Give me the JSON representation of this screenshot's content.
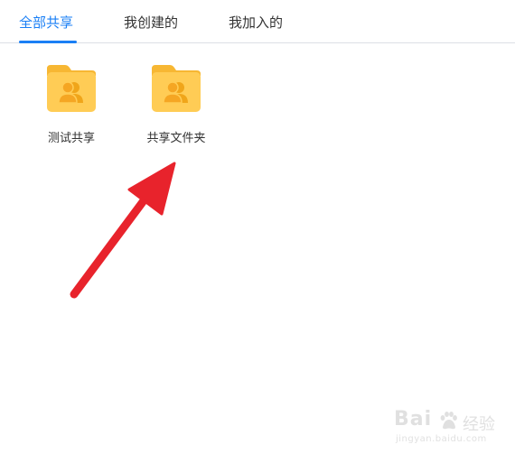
{
  "tabs": [
    {
      "label": "全部共享",
      "active": true
    },
    {
      "label": "我创建的",
      "active": false
    },
    {
      "label": "我加入的",
      "active": false
    }
  ],
  "folders": [
    {
      "name": "测试共享",
      "icon": "shared-folder-icon"
    },
    {
      "name": "共享文件夹",
      "icon": "shared-folder-icon"
    }
  ],
  "annotation": {
    "icon": "red-arrow-icon",
    "color": "#e8232c"
  },
  "watermark": {
    "brand": "Bai",
    "brand_cn": "经验",
    "url": "jingyan.baidu.com"
  },
  "colors": {
    "accent": "#1a7ff5",
    "folder": "#ffc94d",
    "folder_people": "#f0a51a"
  }
}
